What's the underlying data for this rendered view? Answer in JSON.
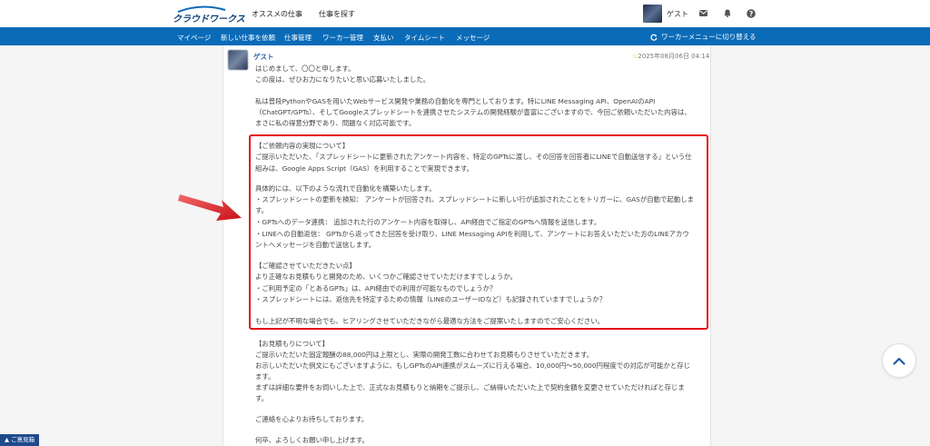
{
  "header": {
    "logo_text": "クラウドワークス",
    "nav": [
      "オススメの仕事",
      "仕事を探す"
    ],
    "user_name": "ゲスト"
  },
  "subnav": {
    "items": [
      "マイページ",
      "新しい仕事を依頼",
      "仕事管理",
      "ワーカー管理",
      "支払い",
      "タイムシート",
      "メッセージ"
    ],
    "switch_label": "ワーカーメニューに切り替える"
  },
  "message": {
    "sender": "ゲスト",
    "date": "2025年08月06日 04:14",
    "lines": [
      "はじめまして、〇〇と申します。",
      "この度は、ぜひお力になりたいと思い応募いたしました。",
      "",
      "私は普段PythonやGASを用いたWebサービス開発や業務の自動化を専門としております。特にLINE Messaging API、OpenAIのAPI",
      "（ChatGPT/GPTs）、そしてGoogleスプレッドシートを連携させたシステムの開発経験が豊富にございますので、今回ご依頼いただいた内容は、",
      "まさに私の得意分野であり、問題なく対応可能です。",
      "",
      "【ご依頼内容の実現について】",
      "ご提示いただいた、「スプレッドシートに更新されたアンケート内容を、特定のGPTsに渡し、その回答を回答者にLINEで自動送信する」という仕",
      "組みは、Google Apps Script（GAS）を利用することで実現できます。",
      "",
      "具体的には、以下のような流れで自動化を構築いたします。",
      "・スプレッドシートの更新を検知： アンケートが回答され、スプレッドシートに新しい行が追加されたことをトリガーに、GASが自動で起動しま",
      "す。",
      "・GPTsへのデータ連携： 追加された行のアンケート内容を取得し、API経由でご指定のGPTsへ情報を送信します。",
      "・LINEへの自動返信： GPTsから返ってきた回答を受け取り、LINE Messaging APIを利用して、アンケートにお答えいただいた方のLINEアカウ",
      "ントへメッセージを自動で送信します。",
      "",
      "【ご確認させていただきたい点】",
      "より正確なお見積もりと開発のため、いくつかご確認させていただけますでしょうか。",
      "・ご利用予定の「とあるGPTs」は、API経由での利用が可能なものでしょうか？",
      "・スプレッドシートには、返信先を特定するための情報（LINEのユーザーIDなど）も記録されていますでしょうか？",
      "",
      "もし上記が不明な場合でも、ヒアリングさせていただきながら最適な方法をご提案いたしますのでご安心ください。",
      "",
      "【お見積もりについて】",
      "ご提示いただいた固定報酬の88,000円は上限とし、実際の開発工数に合わせてお見積もりさせていただきます。",
      "お示しいただいた例文にもございますように、もしGPTsのAPI連携がスムーズに行える場合、10,000円〜50,000円程度での対応が可能かと存じ",
      "ます。",
      "まずは詳細な要件をお伺いした上で、正式なお見積もりと納期をご提示し、ご納得いただいた上で契約金額を変更させていただければと存じま",
      "す。",
      "",
      "ご連絡を心よりお待ちしております。",
      "",
      "何卒、よろしくお願い申し上げます。"
    ]
  },
  "feedback_label": "▲ ご意見箱",
  "colors": {
    "brand_blue": "#0a6bb8",
    "highlight_red": "#e3101d",
    "link_blue": "#1a5ea8"
  },
  "icons": [
    "mail-icon",
    "bell-icon",
    "help-icon",
    "refresh-icon",
    "star-icon",
    "chevron-up-icon",
    "red-arrow-icon"
  ]
}
